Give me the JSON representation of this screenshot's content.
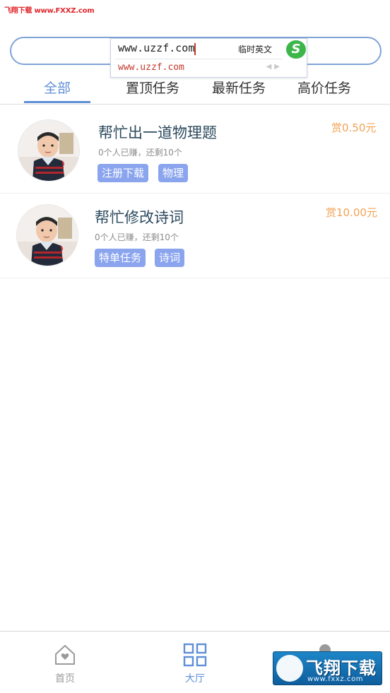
{
  "watermark_top": "飞翔下载 www.FXXZ.com",
  "search": {
    "placeholder": ""
  },
  "ime": {
    "input_text": "www.uzzf.com",
    "mode_label": "临时英文",
    "candidate": "www.uzzf.com",
    "logo_letter": "S"
  },
  "tabs": [
    {
      "label": "全部",
      "active": true
    },
    {
      "label": "置顶任务",
      "active": false
    },
    {
      "label": "最新任务",
      "active": false
    },
    {
      "label": "高价任务",
      "active": false
    }
  ],
  "tasks": [
    {
      "title": "帮忙出一道物理题",
      "subtitle": "0个人已赚，还剩10个",
      "tags": [
        "注册下载",
        "物理"
      ],
      "reward": "赏0.50元"
    },
    {
      "title": "帮忙修改诗词",
      "subtitle": "0个人已赚，还剩10个",
      "tags": [
        "特单任务",
        "诗词"
      ],
      "reward": "赏10.00元"
    }
  ],
  "bottom_nav": [
    {
      "label": "首页",
      "icon": "home-heart-icon",
      "active": false
    },
    {
      "label": "大厅",
      "icon": "grid-icon",
      "active": true
    },
    {
      "label": "",
      "icon": "user-icon",
      "active": false
    }
  ],
  "watermark_bottom": {
    "text": "飞翔下载",
    "url": "www.fxxz.com"
  },
  "colors": {
    "accent": "#5f8fd6",
    "tag_bg": "#8aa4ee",
    "reward": "#f2a356",
    "title": "#2c4a5e"
  }
}
